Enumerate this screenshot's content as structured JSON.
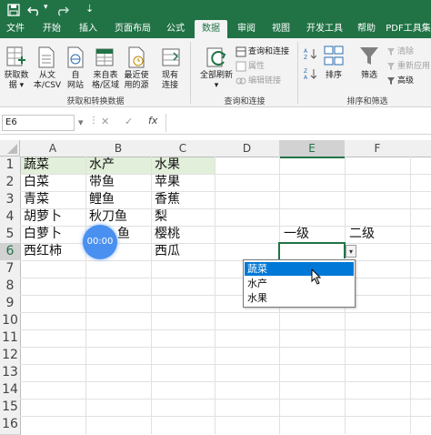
{
  "app": {
    "title_suffix": "⇣",
    "ribbon_tabs": [
      "文件",
      "开始",
      "插入",
      "页面布局",
      "公式",
      "数据",
      "审阅",
      "视图",
      "开发工具",
      "帮助",
      "PDF工具集"
    ],
    "active_tab": "数据"
  },
  "ribbon": {
    "get_data": {
      "line1": "获取数",
      "line2": "据"
    },
    "from_text_csv": {
      "line1": "从文",
      "line2": "本/CSV"
    },
    "from_web": {
      "line1": "自",
      "line2": "网站"
    },
    "from_table": {
      "line1": "来自表",
      "line2": "格/区域"
    },
    "recent_sources": {
      "line1": "最近使",
      "line2": "用的源"
    },
    "existing_connections": {
      "line1": "现有",
      "line2": "连接"
    },
    "refresh_all": {
      "label": "全部刷新"
    },
    "queries_connections": "查询和连接",
    "properties": "属性",
    "edit_links": "编辑链接",
    "sort": "排序",
    "filter": "筛选",
    "clear": "清除",
    "reapply": "重新应用",
    "advanced": "高级",
    "group_get_transform": "获取和转换数据",
    "group_queries": "查询和连接",
    "group_sort_filter": "排序和筛选"
  },
  "formula_bar": {
    "name_box": "E6",
    "cancel_icon": "✕",
    "confirm_icon": "✓",
    "fx_label": "fx",
    "formula": ""
  },
  "sheet": {
    "columns": [
      "A",
      "B",
      "C",
      "D",
      "E",
      "F"
    ],
    "rows": [
      "1",
      "2",
      "3",
      "4",
      "5",
      "6",
      "7",
      "8",
      "9",
      "10",
      "11",
      "12",
      "13",
      "14",
      "15",
      "16"
    ],
    "active_column": "E",
    "active_row": "6",
    "cells": {
      "A1": "蔬菜",
      "B1": "水产",
      "C1": "水果",
      "A2": "白菜",
      "B2": "带鱼",
      "C2": "苹果",
      "A3": "青菜",
      "B3": "鲤鱼",
      "C3": "香蕉",
      "A4": "胡萝卜",
      "B4": "秋刀鱼",
      "C4": "梨",
      "A5": "白萝卜",
      "B5": "鱼",
      "C5": "樱桃",
      "A6": "西红柿",
      "C6": "西瓜",
      "E5": "一级",
      "F5": "二级"
    }
  },
  "dropdown": {
    "options": [
      "蔬菜",
      "水产",
      "水果"
    ],
    "highlighted": "蔬菜"
  },
  "timer_overlay": "00:00",
  "colors": {
    "excel_green": "#217346",
    "header_fill": "#e2efda",
    "highlight_blue": "#0078d7",
    "timer_blue": "#4a90f0"
  }
}
